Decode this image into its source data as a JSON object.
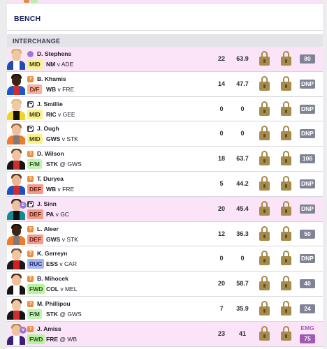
{
  "bench": {
    "title": "BENCH"
  },
  "section": {
    "title": "INTERCHANGE"
  },
  "players": [
    {
      "name": "D. Stephens",
      "status": "captain",
      "status_label": "",
      "badge": "",
      "pos": "MID",
      "team": "NM",
      "sep": "v",
      "opp": "ADE",
      "games": "22",
      "avg": "63.9",
      "score": "80",
      "emg": "",
      "highlight": true,
      "skin": "#f0c7a4",
      "hair": "#d9b067",
      "jersey": "#1e4fb0",
      "stripe": "#ffffff"
    },
    {
      "name": "B. Khamis",
      "status": "question",
      "status_label": "?",
      "badge": "",
      "pos": "D/F",
      "team": "WB",
      "sep": "v",
      "opp": "FRE",
      "games": "14",
      "avg": "47.7",
      "score": "DNP",
      "emg": "",
      "highlight": false,
      "skin": "#3b2417",
      "hair": "#1d120a",
      "jersey": "#1e56c8",
      "stripe": "#d12d2d"
    },
    {
      "name": "J. Smillie",
      "status": "locked",
      "status_label": "",
      "badge": "",
      "pos": "MID",
      "team": "RIC",
      "sep": "v",
      "opp": "GEE",
      "games": "0",
      "avg": "0",
      "score": "DNP",
      "emg": "",
      "highlight": false,
      "skin": "#f1c9a7",
      "hair": "#e0c170",
      "jersey": "#f2d326",
      "stripe": "#111111"
    },
    {
      "name": "J. Ough",
      "status": "locked",
      "status_label": "",
      "badge": "",
      "pos": "MID",
      "team": "GWS",
      "sep": "v",
      "opp": "STK",
      "games": "0",
      "avg": "0",
      "score": "DNP",
      "emg": "",
      "highlight": false,
      "skin": "#edbf9c",
      "hair": "#9a6a3a",
      "jersey": "#ef7a2a",
      "stripe": "#7c7c7c"
    },
    {
      "name": "D. Wilson",
      "status": "question",
      "status_label": "?",
      "badge": "",
      "pos": "F/M",
      "team": "STK",
      "sep": "@",
      "opp": "GWS",
      "games": "18",
      "avg": "63.7",
      "score": "106",
      "emg": "",
      "highlight": false,
      "skin": "#f0c3a0",
      "hair": "#6a4a2a",
      "jersey": "#151515",
      "stripe": "#d12d2d"
    },
    {
      "name": "T. Duryea",
      "status": "question",
      "status_label": "?",
      "badge": "",
      "pos": "DEF",
      "team": "WB",
      "sep": "v",
      "opp": "FRE",
      "games": "5",
      "avg": "44.2",
      "score": "DNP",
      "emg": "",
      "highlight": false,
      "skin": "#e9b891",
      "hair": "#5a3a1f",
      "jersey": "#1f4fbf",
      "stripe": "#d12d2d"
    },
    {
      "name": "J. Sinn",
      "status": "locked",
      "status_label": "",
      "badge": "c",
      "pos": "DEF",
      "team": "PA",
      "sep": "v",
      "opp": "GC",
      "games": "20",
      "avg": "45.4",
      "score": "DNP",
      "emg": "",
      "highlight": true,
      "skin": "#efc19e",
      "hair": "#3f2a19",
      "jersey": "#0d8c92",
      "stripe": "#111111"
    },
    {
      "name": "L. Aleer",
      "status": "question",
      "status_label": "?",
      "badge": "",
      "pos": "DEF",
      "team": "GWS",
      "sep": "v",
      "opp": "STK",
      "games": "12",
      "avg": "36.3",
      "score": "50",
      "emg": "",
      "highlight": false,
      "skin": "#3a2418",
      "hair": "#1a100a",
      "jersey": "#ef7a2a",
      "stripe": "#7c7c7c"
    },
    {
      "name": "K. Gerreyn",
      "status": "question",
      "status_label": "?",
      "badge": "",
      "pos": "RUC",
      "team": "ESS",
      "sep": "v",
      "opp": "CAR",
      "games": "0",
      "avg": "0",
      "score": "DNP",
      "emg": "",
      "highlight": false,
      "skin": "#f0c6a2",
      "hair": "#7a5330",
      "jersey": "#1a1a1a",
      "stripe": "#d22020"
    },
    {
      "name": "B. Mihocek",
      "status": "question",
      "status_label": "?",
      "badge": "",
      "pos": "FWD",
      "team": "COL",
      "sep": "v",
      "opp": "MEL",
      "games": "20",
      "avg": "58.7",
      "score": "40",
      "emg": "",
      "highlight": false,
      "skin": "#efbf9b",
      "hair": "#4a3220",
      "jersey": "#141414",
      "stripe": "#ffffff"
    },
    {
      "name": "M. Phillipou",
      "status": "question",
      "status_label": "?",
      "badge": "",
      "pos": "F/M",
      "team": "STK",
      "sep": "@",
      "opp": "GWS",
      "games": "7",
      "avg": "35.9",
      "score": "24",
      "emg": "",
      "highlight": false,
      "skin": "#f1c6a2",
      "hair": "#3a2616",
      "jersey": "#151515",
      "stripe": "#d12d2d"
    },
    {
      "name": "J. Amiss",
      "status": "question",
      "status_label": "?",
      "badge": "v",
      "pos": "FWD",
      "team": "FRE",
      "sep": "@",
      "opp": "WB",
      "games": "23",
      "avg": "41",
      "score": "75",
      "emg": "EMG",
      "highlight": true,
      "skin": "#f0c3a0",
      "hair": "#b88a4c",
      "jersey": "#3b1f7a",
      "stripe": "#ffffff"
    }
  ],
  "colors": {
    "highlight_row": "#fbe4f8",
    "lock": "#a68c4c",
    "score_badge": "#7f8395",
    "emg": "#a35cb5"
  }
}
